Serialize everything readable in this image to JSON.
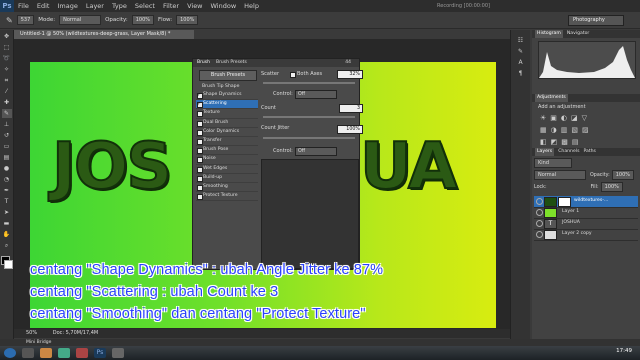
{
  "app": {
    "logo": "Ps",
    "menu": [
      "File",
      "Edit",
      "Image",
      "Layer",
      "Type",
      "Select",
      "Filter",
      "View",
      "Window",
      "Help"
    ],
    "recording": "Recording [00:00:00]"
  },
  "options_bar": {
    "brush_size": "537",
    "mode_label": "Mode:",
    "mode_value": "Normal",
    "opacity_label": "Opacity:",
    "opacity_value": "100%",
    "flow_label": "Flow:",
    "flow_value": "100%",
    "workspace": "Photography"
  },
  "document": {
    "tab_title": "Untitled-1 @ 50% (wildtextures-deep-grass, Layer Mask/8) *",
    "canvas_text_left": "JOS",
    "canvas_text_right": "UA",
    "zoom": "50%",
    "doc_info": "Doc: 5,70M/17,4M"
  },
  "brush_panel": {
    "tabs": [
      "Brush",
      "Brush Presets"
    ],
    "presets_button": "Brush Presets",
    "section_head": "Brush Tip Shape",
    "items": [
      {
        "label": "Shape Dynamics",
        "checked": true,
        "active": false
      },
      {
        "label": "Scattering",
        "checked": true,
        "active": true
      },
      {
        "label": "Texture",
        "checked": false,
        "active": false
      },
      {
        "label": "Dual Brush",
        "checked": false,
        "active": false
      },
      {
        "label": "Color Dynamics",
        "checked": false,
        "active": false
      },
      {
        "label": "Transfer",
        "checked": false,
        "active": false
      },
      {
        "label": "Brush Pose",
        "checked": false,
        "active": false
      },
      {
        "label": "Noise",
        "checked": false,
        "active": false
      },
      {
        "label": "Wet Edges",
        "checked": false,
        "active": false
      },
      {
        "label": "Build-up",
        "checked": false,
        "active": false
      },
      {
        "label": "Smoothing",
        "checked": false,
        "active": false
      },
      {
        "label": "Protect Texture",
        "checked": false,
        "active": false
      }
    ],
    "scatter_label": "Scatter",
    "both_axes_label": "Both Axes",
    "scatter_value": "32%",
    "control_label": "Control:",
    "control_value": "Off",
    "count_label": "Count",
    "count_value": "3",
    "count_jitter_label": "Count Jitter",
    "count_jitter_value": "100%",
    "control2_value": "Off",
    "panel_size": "44"
  },
  "right_panel": {
    "top_tabs": [
      "Histogram",
      "Navigator"
    ],
    "adjust_tab": "Adjustments",
    "add_adjustment": "Add an adjustment",
    "layer_tabs": [
      "Layers",
      "Channels",
      "Paths"
    ],
    "kind_label": "Kind",
    "blend_mode": "Normal",
    "opacity_label": "Opacity:",
    "opacity_value": "100%",
    "lock_label": "Lock:",
    "fill_label": "Fill:",
    "fill_value": "100%",
    "layers": [
      {
        "name": "wildtextures-...",
        "selected": true
      },
      {
        "name": "Layer 1",
        "selected": false
      },
      {
        "name": "JOSHUA",
        "selected": false
      },
      {
        "name": "Layer 2 copy",
        "selected": false
      }
    ]
  },
  "status_bar": {
    "minibridge": "Mini Bridge"
  },
  "taskbar": {
    "clock": "17:49"
  },
  "subtitles": [
    "centang \"Shape Dynamics\" : ubah Angle Jitter ke 87%",
    "centang \"Scattering : ubah Count ke 3",
    "centang \"Smoothing\" dan centang \"Protect Texture\""
  ],
  "colors": {
    "subtitle": "#2a40ff",
    "canvas_left": "#3dd634",
    "canvas_right": "#d8ec10",
    "selection": "#2f6fb5"
  }
}
